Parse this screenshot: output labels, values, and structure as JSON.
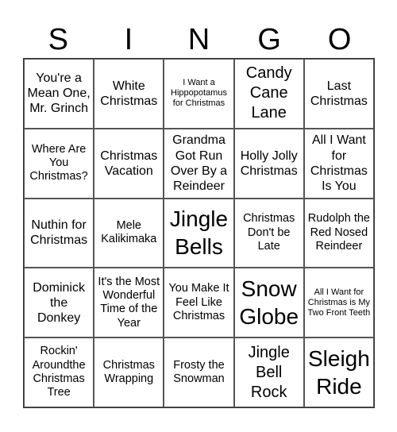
{
  "header": {
    "letters": [
      "S",
      "I",
      "N",
      "G",
      "O"
    ]
  },
  "board": {
    "rows": [
      [
        "You're a Mean One, Mr. Grinch",
        "White Christmas",
        "I Want a Hippopotamus for Christmas",
        "Candy Cane Lane",
        "Last Christmas"
      ],
      [
        "Where Are You Christmas?",
        "Christmas Vacation",
        "Grandma Got Run Over By a Reindeer",
        "Holly Jolly Christmas",
        "All I Want for Christmas Is You"
      ],
      [
        "Nuthin for Christmas",
        "Mele Kalikimaka",
        "Jingle Bells",
        "Christmas Don't be Late",
        "Rudolph the Red Nosed Reindeer"
      ],
      [
        "Dominick the Donkey",
        "It's the Most Wonderful Time of the Year",
        "You Make It Feel Like Christmas",
        "Snow Globe",
        "All I Want for Christmas is My Two Front Teeth"
      ],
      [
        "Rockin' Aroundthe Christmas Tree",
        "Christmas Wrapping",
        "Frosty the Snowman",
        "Jingle Bell Rock",
        "Sleigh Ride"
      ]
    ]
  }
}
